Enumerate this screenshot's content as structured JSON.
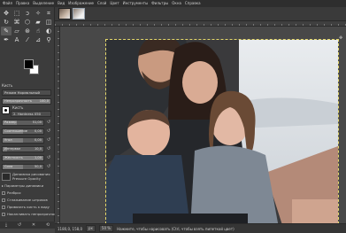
{
  "menubar": {
    "items": [
      "Файл",
      "Правка",
      "Выделение",
      "Вид",
      "Изображение",
      "Слой",
      "Цвет",
      "Инструменты",
      "Фильтры",
      "Окна",
      "Справка"
    ]
  },
  "tools": [
    {
      "icon": "move-icon",
      "glyph": "✥"
    },
    {
      "icon": "rect-select-icon",
      "glyph": "⬚"
    },
    {
      "icon": "lasso-icon",
      "glyph": "ↄ"
    },
    {
      "icon": "fuzzy-select-icon",
      "glyph": "✧"
    },
    {
      "icon": "crop-icon",
      "glyph": "⌗"
    },
    {
      "icon": "rotate-icon",
      "glyph": "↻"
    },
    {
      "icon": "warp-icon",
      "glyph": "⌘"
    },
    {
      "icon": "cage-icon",
      "glyph": "⬡"
    },
    {
      "icon": "bucket-fill-icon",
      "glyph": "▰"
    },
    {
      "icon": "gradient-icon",
      "glyph": "◫"
    },
    {
      "icon": "paintbrush-icon",
      "glyph": "✎"
    },
    {
      "icon": "eraser-icon",
      "glyph": "▱"
    },
    {
      "icon": "clone-icon",
      "glyph": "⊛"
    },
    {
      "icon": "smudge-icon",
      "glyph": "☝"
    },
    {
      "icon": "dodge-icon",
      "glyph": "◐"
    },
    {
      "icon": "paths-icon",
      "glyph": "✒"
    },
    {
      "icon": "text-icon",
      "glyph": "A"
    },
    {
      "icon": "color-picker-icon",
      "glyph": "⁄"
    },
    {
      "icon": "measure-icon",
      "glyph": "⊿"
    },
    {
      "icon": "zoom-icon",
      "glyph": "⚲"
    }
  ],
  "tool_options": {
    "section_title": "Кисть",
    "mode_label": "Режим",
    "mode_value": "Нормальный",
    "opacity_label": "Непрозрачность",
    "opacity_value": "100,0",
    "brush_label": "Кисть",
    "brush_name": "2. Hardness 050",
    "sliders": [
      {
        "label": "Размер",
        "value": "51,00",
        "level": 0.35
      },
      {
        "label": "Соотношение",
        "value": "0,00",
        "level": 0.5
      },
      {
        "label": "Угол",
        "value": "0,00",
        "level": 0.5
      },
      {
        "label": "Интервал",
        "value": "10,0",
        "level": 0.1
      },
      {
        "label": "Жёсткость",
        "value": "1,00",
        "level": 1.0
      },
      {
        "label": "Сила",
        "value": "50,0",
        "level": 0.5
      }
    ],
    "dynamics_label": "Динамика рисования",
    "dynamics_value": "Pressure Opacity",
    "checks": [
      "Параметры динамики",
      "Разброс",
      "Сглаживание штрихов",
      "Привязать кисть к виду",
      "Наложение"
    ],
    "extra_check": "Накапливать непрозрачность"
  },
  "statusbar": {
    "coords": "1180,0, 158,0",
    "units": "px",
    "zoom": "50 %",
    "message": "Нажмите, чтобы нарисовать (Ctrl, чтобы взять пипеткой цвет)"
  },
  "colors": {
    "foreground": "#000000",
    "background": "#ffffff",
    "selection_outline": "#e5d86b"
  }
}
